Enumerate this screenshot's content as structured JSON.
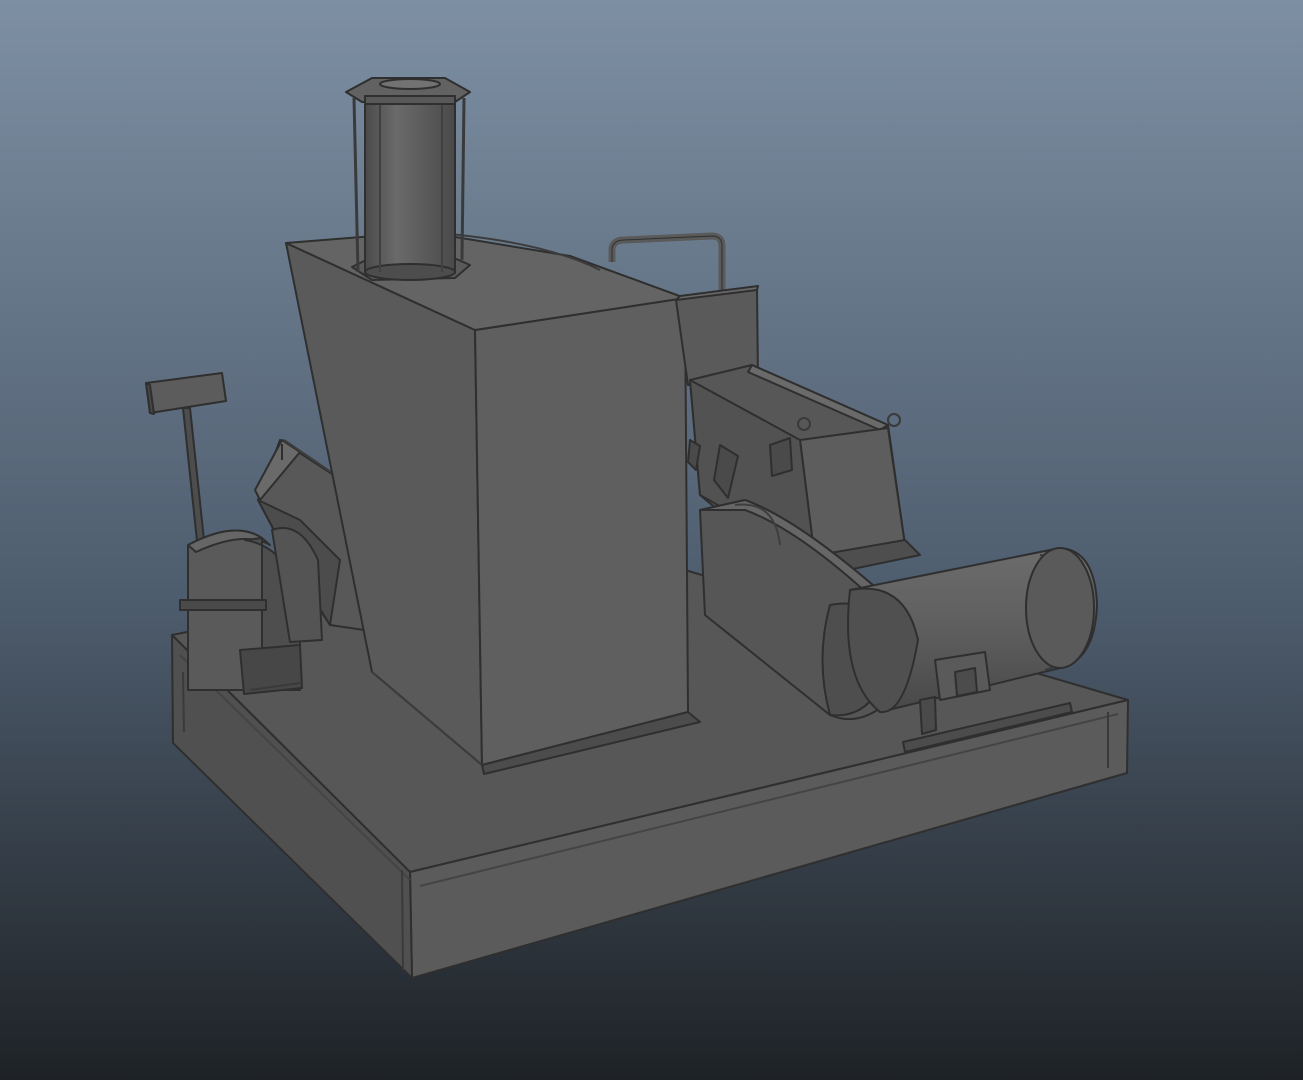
{
  "scene": {
    "subject": "3d-industrial-machine-model",
    "shading": "flat-grey",
    "colors": {
      "background_top": "#7d8fa3",
      "background_mid": "#4e5d6e",
      "background_bottom": "#1e2226",
      "model_base": "#5c5c5c",
      "model_light": "#6e6e6e",
      "model_mid": "#555555",
      "model_dark": "#434343",
      "model_edge": "#2f2f2f"
    }
  }
}
